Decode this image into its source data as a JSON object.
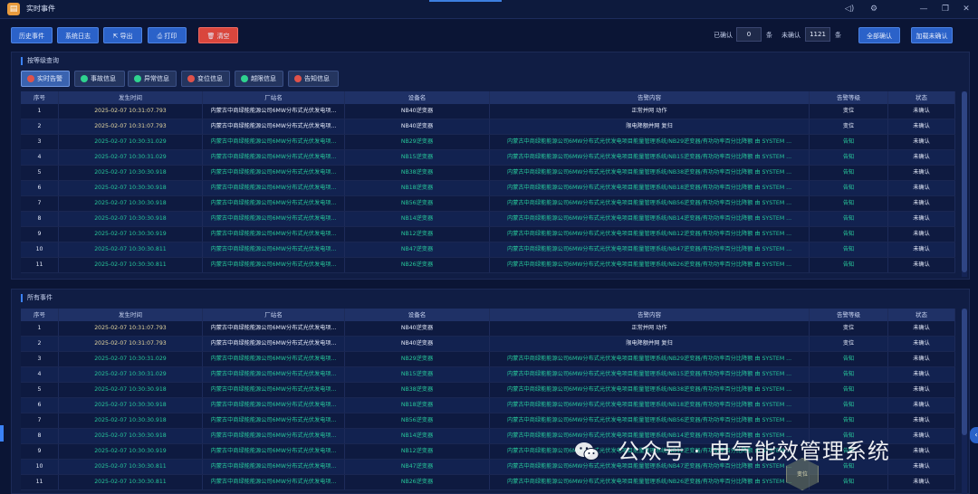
{
  "window": {
    "title": "实时事件"
  },
  "toolbar": {
    "history": "历史事件",
    "syslog": "系统日志",
    "export": "导出",
    "print": "打印",
    "clear": "清空",
    "confirmed_label": "已确认",
    "confirmed_count": "0",
    "unconfirmed_label": "未确认",
    "unconfirmed_count": "1121",
    "unit": "条",
    "confirm_all": "全部确认",
    "load_unconfirmed": "加载未确认"
  },
  "top_panel": {
    "title": "按等级查询",
    "filters": [
      {
        "label": "实时告警",
        "color": "#e0524a"
      },
      {
        "label": "事故信息",
        "color": "#2fd38f"
      },
      {
        "label": "异常信息",
        "color": "#2fd38f"
      },
      {
        "label": "变位信息",
        "color": "#e0524a"
      },
      {
        "label": "越限信息",
        "color": "#2fd38f"
      },
      {
        "label": "告知信息",
        "color": "#e0524a"
      }
    ]
  },
  "bottom_panel": {
    "title": "所有事件"
  },
  "columns": [
    "序号",
    "发生时间",
    "厂站名",
    "设备名",
    "告警内容",
    "告警等级",
    "状态"
  ],
  "rows": [
    {
      "no": "1",
      "time": "2025-02-07 10:31:07.793",
      "station": "内蒙古中商绿能能源公司6MW分布式光伏发电项...",
      "device": "NB40逆变器",
      "content": "正常并网 动作",
      "level": "变位",
      "status": "未确认",
      "tone": "white"
    },
    {
      "no": "2",
      "time": "2025-02-07 10:31:07.793",
      "station": "内蒙古中商绿能能源公司6MW分布式光伏发电项...",
      "device": "NB40逆变器",
      "content": "限电降额并网 复归",
      "level": "变位",
      "status": "未确认",
      "tone": "white"
    },
    {
      "no": "3",
      "time": "2025-02-07 10:30:31.029",
      "station": "内蒙古中商绿能能源公司6MW分布式光伏发电项...",
      "device": "NB29逆变器",
      "content": "内蒙古中商绿能能源公司6MW分布式光伏发电项目能量管理系统/NB29逆变器/有功功率百分比降额 由 SYSTEM ...",
      "level": "告知",
      "status": "未确认",
      "tone": "green"
    },
    {
      "no": "4",
      "time": "2025-02-07 10:30:31.029",
      "station": "内蒙古中商绿能能源公司6MW分布式光伏发电项...",
      "device": "NB15逆变器",
      "content": "内蒙古中商绿能能源公司6MW分布式光伏发电项目能量管理系统/NB15逆变器/有功功率百分比降额 由 SYSTEM ...",
      "level": "告知",
      "status": "未确认",
      "tone": "green"
    },
    {
      "no": "5",
      "time": "2025-02-07 10:30:30.918",
      "station": "内蒙古中商绿能能源公司6MW分布式光伏发电项...",
      "device": "NB38逆变器",
      "content": "内蒙古中商绿能能源公司6MW分布式光伏发电项目能量管理系统/NB38逆变器/有功功率百分比降额 由 SYSTEM ...",
      "level": "告知",
      "status": "未确认",
      "tone": "green"
    },
    {
      "no": "6",
      "time": "2025-02-07 10:30:30.918",
      "station": "内蒙古中商绿能能源公司6MW分布式光伏发电项...",
      "device": "NB18逆变器",
      "content": "内蒙古中商绿能能源公司6MW分布式光伏发电项目能量管理系统/NB18逆变器/有功功率百分比降额 由 SYSTEM ...",
      "level": "告知",
      "status": "未确认",
      "tone": "green"
    },
    {
      "no": "7",
      "time": "2025-02-07 10:30:30.918",
      "station": "内蒙古中商绿能能源公司6MW分布式光伏发电项...",
      "device": "NB56逆变器",
      "content": "内蒙古中商绿能能源公司6MW分布式光伏发电项目能量管理系统/NB56逆变器/有功功率百分比降额 由 SYSTEM ...",
      "level": "告知",
      "status": "未确认",
      "tone": "green"
    },
    {
      "no": "8",
      "time": "2025-02-07 10:30:30.918",
      "station": "内蒙古中商绿能能源公司6MW分布式光伏发电项...",
      "device": "NB14逆变器",
      "content": "内蒙古中商绿能能源公司6MW分布式光伏发电项目能量管理系统/NB14逆变器/有功功率百分比降额 由 SYSTEM ...",
      "level": "告知",
      "status": "未确认",
      "tone": "green"
    },
    {
      "no": "9",
      "time": "2025-02-07 10:30:30.919",
      "station": "内蒙古中商绿能能源公司6MW分布式光伏发电项...",
      "device": "NB12逆变器",
      "content": "内蒙古中商绿能能源公司6MW分布式光伏发电项目能量管理系统/NB12逆变器/有功功率百分比降额 由 SYSTEM ...",
      "level": "告知",
      "status": "未确认",
      "tone": "green"
    },
    {
      "no": "10",
      "time": "2025-02-07 10:30:30.811",
      "station": "内蒙古中商绿能能源公司6MW分布式光伏发电项...",
      "device": "NB47逆变器",
      "content": "内蒙古中商绿能能源公司6MW分布式光伏发电项目能量管理系统/NB47逆变器/有功功率百分比降额 由 SYSTEM ...",
      "level": "告知",
      "status": "未确认",
      "tone": "green"
    },
    {
      "no": "11",
      "time": "2025-02-07 10:30:30.811",
      "station": "内蒙古中商绿能能源公司6MW分布式光伏发电项...",
      "device": "NB26逆变器",
      "content": "内蒙古中商绿能能源公司6MW分布式光伏发电项目能量管理系统/NB26逆变器/有功功率百分比降额 由 SYSTEM ...",
      "level": "告知",
      "status": "未确认",
      "tone": "green"
    }
  ],
  "watermark": {
    "text": "公众号 · 电气能效管理系统",
    "badge": "变位"
  }
}
